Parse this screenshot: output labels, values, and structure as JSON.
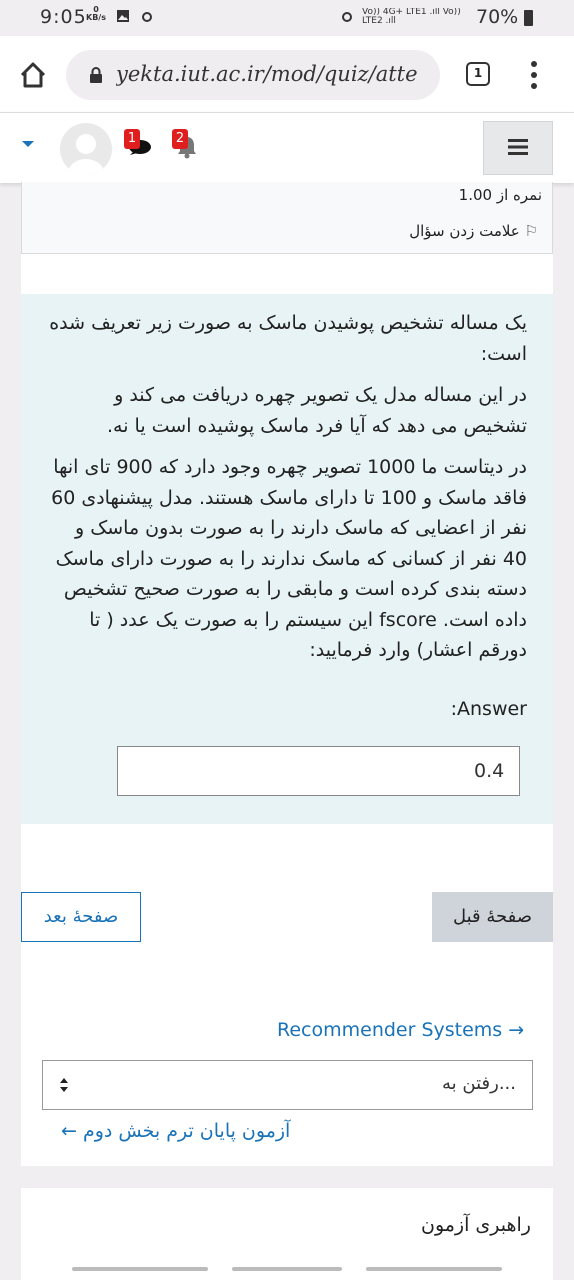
{
  "status_bar": {
    "time": "9:05",
    "speed_value": "0",
    "speed_unit": "KB/s",
    "network": "Vo)) 4G+ LTE1 .ıll Vo)) LTE2 .ıll",
    "battery": "70%"
  },
  "browser": {
    "url": "yekta.iut.ac.ir/mod/quiz/atte",
    "tab_count": "1"
  },
  "header": {
    "messages_badge": "1",
    "notifications_badge": "2"
  },
  "question_info": {
    "mark": "نمره از 1.00",
    "flag_label": "علامت زدن سؤال"
  },
  "question": {
    "para1": "یک مساله تشخیص پوشیدن ماسک به صورت زیر تعریف شده است:",
    "para2": "در این مساله مدل یک تصویر چهره دریافت می کند و تشخیص می دهد که آیا فرد ماسک پوشیده است یا نه.",
    "para3": "در دیتاست ما 1000 تصویر چهره وجود دارد که 900 تای انها فاقد ماسک و 100 تا دارای ماسک هستند. مدل پیشنهادی 60 نفر از اعضایی که ماسک دارند را به صورت بدون ماسک و 40 نفر از کسانی که ماسک ندارند را به صورت دارای ماسک دسته بندی کرده است و مابقی را به صورت صحیح تشخیص داده است. fscore این سیستم را به صورت یک عدد ( تا دورقم اعشار) وارد فرمایید:",
    "answer_label": "Answer:",
    "answer_value": "0.4"
  },
  "navigation": {
    "next_button": "صفحهٔ بعد",
    "prev_button": "صفحهٔ قبل",
    "recommender_link": "Recommender Systems →",
    "jump_placeholder": "رفتن به...",
    "previous_activity_link": "آزمون پایان ترم بخش دوم ←"
  },
  "quiz_nav": {
    "title": "راهبری آزمون"
  },
  "colors": {
    "accent": "#1a73b8",
    "question_bg": "#e7f3f5",
    "badge_red": "#e01e1e"
  }
}
